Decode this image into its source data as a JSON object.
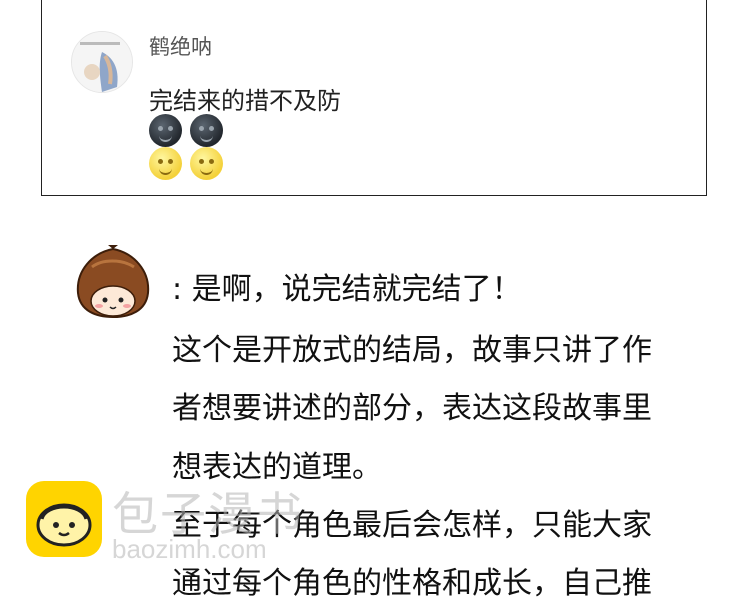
{
  "comment": {
    "username": "鹤绝呐",
    "text": "完结来的措不及防",
    "emojis_row1": [
      "dark-moon-face-emoji",
      "dark-moon-face-emoji"
    ],
    "emojis_row2": [
      "smiling-sun-face-emoji",
      "smiling-sun-face-emoji"
    ]
  },
  "reply": {
    "first_line": ": 是啊，说完结就完结了！",
    "lines": [
      "这个是开放式的结局，故事只讲了作",
      "者想要讲述的部分，表达这段故事里",
      "想表达的道理。",
      "至于每个角色最后会怎样，只能大家",
      "通过每个角色的性格和成长，自己推"
    ]
  },
  "watermark": {
    "title": "包子漫书",
    "url": "baozimh.com"
  },
  "colors": {
    "card_border": "#222222",
    "text": "#111111",
    "watermark_logo": "#ffd400"
  }
}
